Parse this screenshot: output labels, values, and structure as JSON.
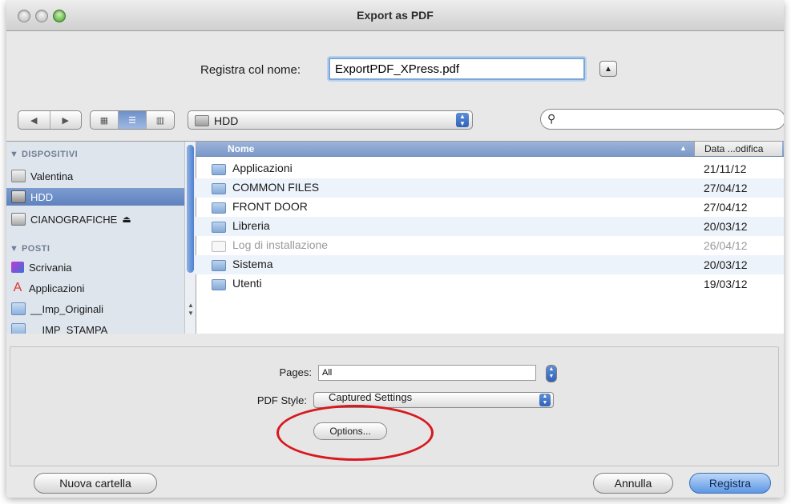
{
  "window": {
    "title": "Export as PDF"
  },
  "save": {
    "label": "Registra col nome:",
    "filename": "ExportPDF_XPress.pdf"
  },
  "toolbar": {
    "location": "HDD",
    "search_placeholder": ""
  },
  "sidebar": {
    "devices_header": "▼ DISPOSITIVI",
    "places_header": "▼ POSTI",
    "devices": [
      {
        "label": "Valentina",
        "selected": false
      },
      {
        "label": "HDD",
        "selected": true
      },
      {
        "label": "CIANOGRAFICHE",
        "eject": "⏏"
      }
    ],
    "places": [
      {
        "label": "Scrivania"
      },
      {
        "label": "Applicazioni"
      },
      {
        "label": "__Imp_Originali"
      },
      {
        "label": "__IMP_STAMPA"
      }
    ]
  },
  "files": {
    "col_name": "Nome",
    "col_date": "Data ...odifica",
    "rows": [
      {
        "name": "Applicazioni",
        "date": "21/11/12"
      },
      {
        "name": "COMMON FILES",
        "date": "27/04/12"
      },
      {
        "name": "FRONT DOOR",
        "date": "27/04/12"
      },
      {
        "name": "Libreria",
        "date": "20/03/12"
      },
      {
        "name": "Log di installazione",
        "date": "26/04/12"
      },
      {
        "name": "Sistema",
        "date": "20/03/12"
      },
      {
        "name": "Utenti",
        "date": "19/03/12"
      }
    ]
  },
  "options": {
    "pages_label": "Pages:",
    "pages_value": "All",
    "style_label": "PDF Style:",
    "style_value": "Captured Settings",
    "options_button": "Options..."
  },
  "buttons": {
    "new_folder": "Nuova cartella",
    "cancel": "Annulla",
    "save": "Registra"
  },
  "colors": {
    "accent": "#5d97e4",
    "highlight_circle": "#d71920",
    "sidebar": "#dfe5ed"
  }
}
